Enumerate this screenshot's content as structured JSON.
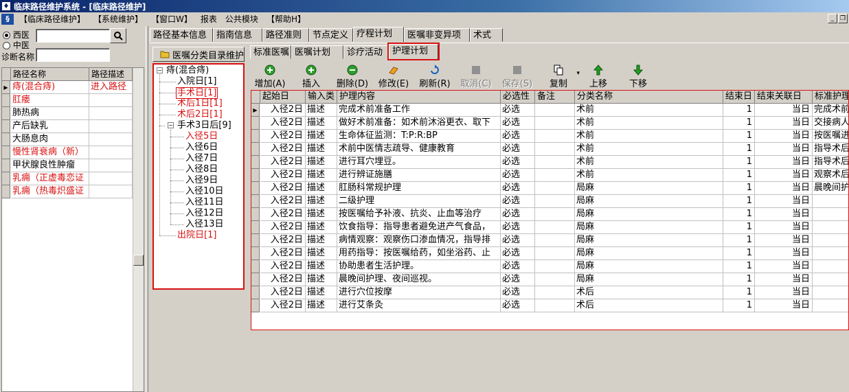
{
  "window": {
    "title": "临床路径维护系统 - [临床路径维护]"
  },
  "menu": {
    "items": [
      "【临床路径维护】",
      "【系统维护】",
      "【窗口W】",
      "报表",
      "公共模块",
      "【帮助H】"
    ]
  },
  "filters": {
    "medicine_type": {
      "options": [
        "西医",
        "中医"
      ],
      "selected": "西医"
    },
    "search_value": "",
    "diagnosis_label": "诊断名称",
    "diagnosis_value": ""
  },
  "path_list": {
    "columns": [
      "路径名称",
      "路径描述"
    ],
    "rows": [
      {
        "name": "痔(混合痔)",
        "desc": "进入路径",
        "color": "#d81010",
        "selected": true
      },
      {
        "name": "肛瘘",
        "desc": "",
        "color": "#d81010"
      },
      {
        "name": "肺热病",
        "desc": "",
        "color": "#000000"
      },
      {
        "name": "产后缺乳",
        "desc": "",
        "color": "#000000"
      },
      {
        "name": "大肠息肉",
        "desc": "",
        "color": "#000000"
      },
      {
        "name": "慢性肾衰病（新）",
        "desc": "",
        "color": "#d81010"
      },
      {
        "name": "甲状腺良性肿瘤",
        "desc": "",
        "color": "#000000"
      },
      {
        "name": "乳痈（正虚毒恋证",
        "desc": "",
        "color": "#d81010"
      },
      {
        "name": "乳痈（热毒炽盛证",
        "desc": "",
        "color": "#d81010"
      }
    ]
  },
  "main_tabs": [
    "路径基本信息",
    "指南信息",
    "路径准则",
    "节点定义",
    "疗程计划",
    "医嘱非变异项",
    "术式"
  ],
  "main_tab_active": "疗程计划",
  "tree_header": "医嘱分类目录维护",
  "tree": {
    "root": "痔(混合痔)",
    "nodes": [
      {
        "label": "入院日[1]",
        "red": false
      },
      {
        "label": "手术日[1]",
        "red": true,
        "selected": true
      },
      {
        "label": "术后1日[1]",
        "red": true
      },
      {
        "label": "术后2日[1]",
        "red": true
      },
      {
        "label": "手术3日后[9]",
        "red": false,
        "expanded": true,
        "children": [
          {
            "label": "入径5日",
            "red": true
          },
          {
            "label": "入径6日",
            "red": false
          },
          {
            "label": "入径7日",
            "red": false
          },
          {
            "label": "入径8日",
            "red": false
          },
          {
            "label": "入径9日",
            "red": false
          },
          {
            "label": "入径10日",
            "red": false
          },
          {
            "label": "入径11日",
            "red": false
          },
          {
            "label": "入径12日",
            "red": false
          },
          {
            "label": "入径13日",
            "red": false
          }
        ]
      },
      {
        "label": "出院日[1]",
        "red": true
      }
    ]
  },
  "sub_tabs": [
    "标准医嘱",
    "医嘱计划",
    "诊疗活动",
    "护理计划"
  ],
  "sub_tab_active": "护理计划",
  "toolbar": [
    {
      "label": "增加(A)",
      "icon": "add-icon",
      "enabled": true
    },
    {
      "label": "插入",
      "icon": "insert-icon",
      "enabled": true
    },
    {
      "label": "删除(D)",
      "icon": "delete-icon",
      "enabled": true
    },
    {
      "label": "修改(E)",
      "icon": "edit-icon",
      "enabled": true
    },
    {
      "label": "刷新(R)",
      "icon": "refresh-icon",
      "enabled": true
    },
    {
      "label": "取消(C)",
      "icon": "cancel-icon",
      "enabled": false
    },
    {
      "label": "保存(S)",
      "icon": "save-icon",
      "enabled": false
    },
    {
      "label": "复制",
      "icon": "copy-icon",
      "enabled": true
    },
    {
      "label": "上移",
      "icon": "up-arrow-icon",
      "enabled": true
    },
    {
      "label": "下移",
      "icon": "down-arrow-icon",
      "enabled": true
    }
  ],
  "care_plan": {
    "columns": [
      "起始日",
      "输入类",
      "护理内容",
      "必选性",
      "备注",
      "分类名称",
      "结束日",
      "结束关联日",
      "标准护理"
    ],
    "rows": [
      [
        "入径2日",
        "描述",
        "完成术前准备工作",
        "必选",
        "",
        "术前",
        "1",
        "当日",
        "完成术前"
      ],
      [
        "入径2日",
        "描述",
        "做好术前准备：如术前沐浴更衣、取下",
        "必选",
        "",
        "术前",
        "1",
        "当日",
        "交接病人"
      ],
      [
        "入径2日",
        "描述",
        "生命体征监测：T:P:R:BP",
        "必选",
        "",
        "术前",
        "1",
        "当日",
        "按医嘱进"
      ],
      [
        "入径2日",
        "描述",
        "术前中医情志疏导、健康教育",
        "必选",
        "",
        "术前",
        "1",
        "当日",
        "指导术后"
      ],
      [
        "入径2日",
        "描述",
        "进行耳穴埋豆。",
        "必选",
        "",
        "术前",
        "1",
        "当日",
        "指导术后"
      ],
      [
        "入径2日",
        "描述",
        "进行辨证施膳",
        "必选",
        "",
        "术前",
        "1",
        "当日",
        "观察术后"
      ],
      [
        "入径2日",
        "描述",
        "肛肠科常规护理",
        "必选",
        "",
        "局麻",
        "1",
        "当日",
        "晨晚间护"
      ],
      [
        "入径2日",
        "描述",
        "二级护理",
        "必选",
        "",
        "局麻",
        "1",
        "当日",
        ""
      ],
      [
        "入径2日",
        "描述",
        "按医嘱给予补液、抗炎、止血等治疗",
        "必选",
        "",
        "局麻",
        "1",
        "当日",
        ""
      ],
      [
        "入径2日",
        "描述",
        "饮食指导：指导患者避免进产气食品，",
        "必选",
        "",
        "局麻",
        "1",
        "当日",
        ""
      ],
      [
        "入径2日",
        "描述",
        "病情观察：观察伤口渗血情况，指导排",
        "必选",
        "",
        "局麻",
        "1",
        "当日",
        ""
      ],
      [
        "入径2日",
        "描述",
        "用药指导：按医嘱给药，如坐浴药、止",
        "必选",
        "",
        "局麻",
        "1",
        "当日",
        ""
      ],
      [
        "入径2日",
        "描述",
        "协助患者生活护理。",
        "必选",
        "",
        "局麻",
        "1",
        "当日",
        ""
      ],
      [
        "入径2日",
        "描述",
        "晨晚间护理、夜间巡视。",
        "必选",
        "",
        "局麻",
        "1",
        "当日",
        ""
      ],
      [
        "入径2日",
        "描述",
        "进行穴位按摩",
        "必选",
        "",
        "术后",
        "1",
        "当日",
        ""
      ],
      [
        "入径2日",
        "描述",
        "进行艾条灸",
        "必选",
        "",
        "术后",
        "1",
        "当日",
        ""
      ]
    ]
  },
  "colors": {
    "highlight_red": "#d81010",
    "title_blue": "#0a246a",
    "face": "#d4d0c8"
  }
}
